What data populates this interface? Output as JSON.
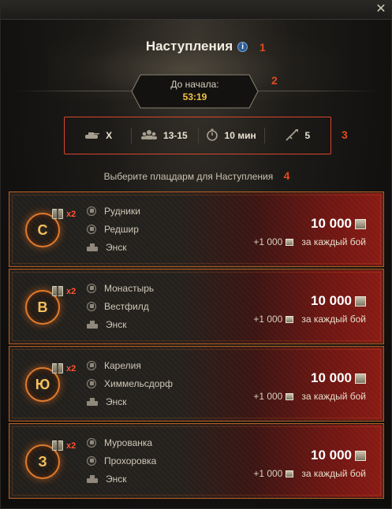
{
  "window": {
    "close_icon": "close-icon"
  },
  "header": {
    "title": "Наступления",
    "info_icon": "info-icon",
    "marker": "1"
  },
  "timer": {
    "label": "До начала:",
    "value": "53:19",
    "marker": "2"
  },
  "params": {
    "marker": "3",
    "items": [
      {
        "icon": "tank-icon",
        "value": "X"
      },
      {
        "icon": "players-icon",
        "value": "13-15"
      },
      {
        "icon": "stopwatch-icon",
        "value": "10 мин"
      },
      {
        "icon": "battle-icon",
        "value": "5"
      }
    ]
  },
  "prompt": {
    "text": "Выберите плацдарм для Наступления",
    "marker": "4"
  },
  "directions": [
    {
      "letter": "С",
      "multiplier": "x2",
      "maps": [
        "Рудники",
        "Редшир",
        "Энск"
      ],
      "reward": "10 000",
      "per_battle_amount": "+1 000",
      "per_battle_text": "за каждый бой"
    },
    {
      "letter": "В",
      "multiplier": "x2",
      "maps": [
        "Монастырь",
        "Вестфилд",
        "Энск"
      ],
      "reward": "10 000",
      "per_battle_amount": "+1 000",
      "per_battle_text": "за каждый бой"
    },
    {
      "letter": "Ю",
      "multiplier": "x2",
      "maps": [
        "Карелия",
        "Химмельсдорф",
        "Энск"
      ],
      "reward": "10 000",
      "per_battle_amount": "+1 000",
      "per_battle_text": "за каждый бой"
    },
    {
      "letter": "З",
      "multiplier": "x2",
      "maps": [
        "Мурованка",
        "Прохоровка",
        "Энск"
      ],
      "reward": "10 000",
      "per_battle_amount": "+1 000",
      "per_battle_text": "за каждый бой"
    }
  ],
  "colors": {
    "accent": "#e04a1f",
    "timer": "#f1c34b",
    "card_red": "#8a1a14"
  }
}
